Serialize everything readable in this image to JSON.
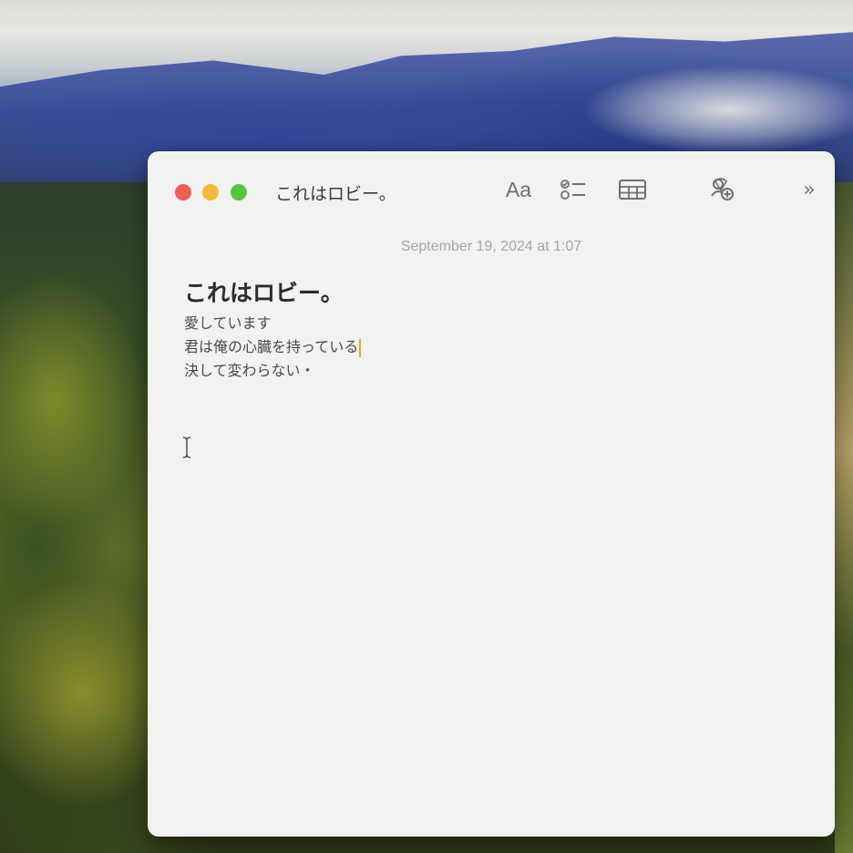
{
  "window": {
    "title": "これはロビー。"
  },
  "toolbar": {
    "format_label": "Aa",
    "icons": [
      "checklist-icon",
      "table-icon",
      "collaborate-icon",
      "more-icon"
    ],
    "more_label": "»"
  },
  "note": {
    "date": "September 19, 2024 at 1:07",
    "heading": "これはロビー。",
    "lines": [
      "愛しています",
      "君は俺の心臓を持っている",
      "決して変わらない・"
    ]
  },
  "colors": {
    "close": "#ed5e57",
    "minimize": "#f3b93c",
    "zoom": "#59c43f",
    "caret": "#e9a825"
  }
}
